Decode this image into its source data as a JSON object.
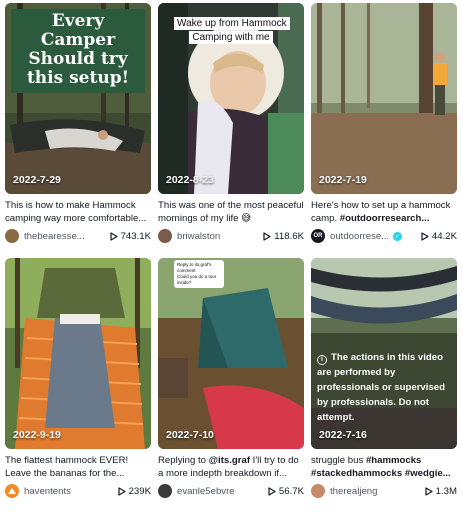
{
  "videos": [
    {
      "overlay_title": "Every Camper Should try this setup!",
      "date": "2022-7-29",
      "description": "This is how to make Hammock camping way more comfortable...",
      "author": "thebearesse...",
      "views": "743.1K",
      "avatar_color": "#8a6a45"
    },
    {
      "overlay_caption": "Wake up from Hammock Camping with me",
      "date": "2022-8-23",
      "description": "This was one of the most peaceful mornings of my life 😅",
      "author": "briwalston",
      "views": "118.6K",
      "avatar_color": "#7b5b4a"
    },
    {
      "date": "2022-7-19",
      "description_parts": [
        "Here's how to set up a hammock camp. ",
        "#outdoorresearch..."
      ],
      "author": "outdoorrese...",
      "avatar_text": "OR",
      "verified": true,
      "views": "44.2K",
      "avatar_color": "#161823"
    },
    {
      "date": "2022-9-19",
      "description": "The flattest hammock EVER! Leave the bananas for the...",
      "author": "haventents",
      "views": "239K",
      "avatar_color": "#f08a2a"
    },
    {
      "reply_bubble": "Reply to its.graf's comment\nCould you do a tour inside?",
      "date": "2022-7-10",
      "description_parts": [
        "Replying to ",
        "@its.graf",
        " I'll try to do a more indepth breakdown if..."
      ],
      "author": "evanle5ebvre",
      "views": "56.7K",
      "avatar_color": "#3a3a3a"
    },
    {
      "warning": "The actions in this video are performed by professionals or supervised by professionals. Do not attempt.",
      "date": "2022-7-16",
      "description_parts": [
        "struggle bus ",
        "#hammocks #stackedhammocks #wedgie..."
      ],
      "author": "therealjeng",
      "views": "1.3M",
      "avatar_color": "#c98a6a"
    }
  ],
  "colors": {
    "text": "#161823",
    "verified": "#20d5ec",
    "title_banner": "#2c5a3c"
  },
  "icons": {
    "views": "play-outline-icon",
    "verified": "check-badge-icon",
    "warning": "info-icon"
  }
}
